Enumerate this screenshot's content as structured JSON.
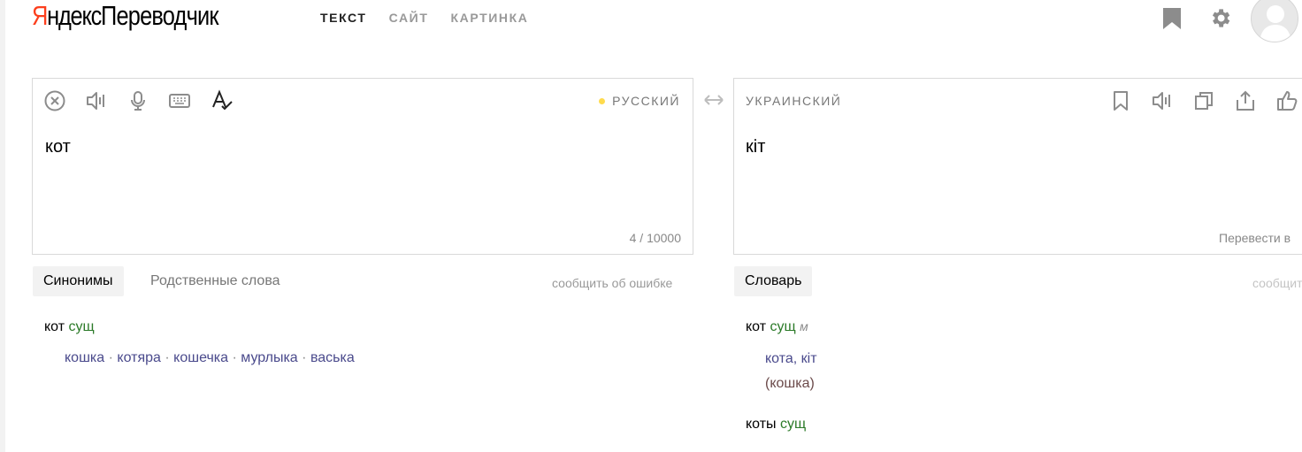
{
  "header": {
    "logo_brand_first": "Я",
    "logo_brand_rest": "ндекс",
    "logo_service": "Переводчик",
    "nav": [
      {
        "label": "ТЕКСТ",
        "active": true
      },
      {
        "label": "САЙТ",
        "active": false
      },
      {
        "label": "КАРТИНКА",
        "active": false
      }
    ],
    "icons": [
      "bookmark-icon",
      "gear-icon",
      "avatar"
    ]
  },
  "source": {
    "language": "РУССКИЙ",
    "text": "кот",
    "counter": "4 / 10000",
    "tools": [
      "clear-icon",
      "speaker-icon",
      "microphone-icon",
      "keyboard-icon",
      "spellcheck-icon"
    ]
  },
  "target": {
    "language": "УКРАИНСКИЙ",
    "text": "кіт",
    "translate_in": "Перевести в ",
    "tools": [
      "bookmark-icon",
      "speaker-icon",
      "copy-icon",
      "share-icon",
      "like-icon"
    ]
  },
  "left_tabs": {
    "synonyms": "Синонимы",
    "related": "Родственные слова",
    "report": "сообщить об ошибке"
  },
  "right_tabs": {
    "dictionary": "Словарь",
    "report": "сообщить"
  },
  "synonyms": {
    "word": "кот",
    "pos": "сущ",
    "items": [
      "кошка",
      "котяра",
      "кошечка",
      "мурлыка",
      "васька"
    ],
    "separator": "·"
  },
  "dictionary": {
    "entries": [
      {
        "word": "кот",
        "pos": "сущ",
        "gender": "м",
        "translations": "кота, кіт",
        "gloss": "(кошка)"
      },
      {
        "word": "коты",
        "pos": "сущ"
      }
    ]
  },
  "colors": {
    "accent_logo": "#fc3f1d",
    "lang_dot": "#ffdb4d",
    "pos": "#2b7a28",
    "link": "#4a4a8c"
  }
}
